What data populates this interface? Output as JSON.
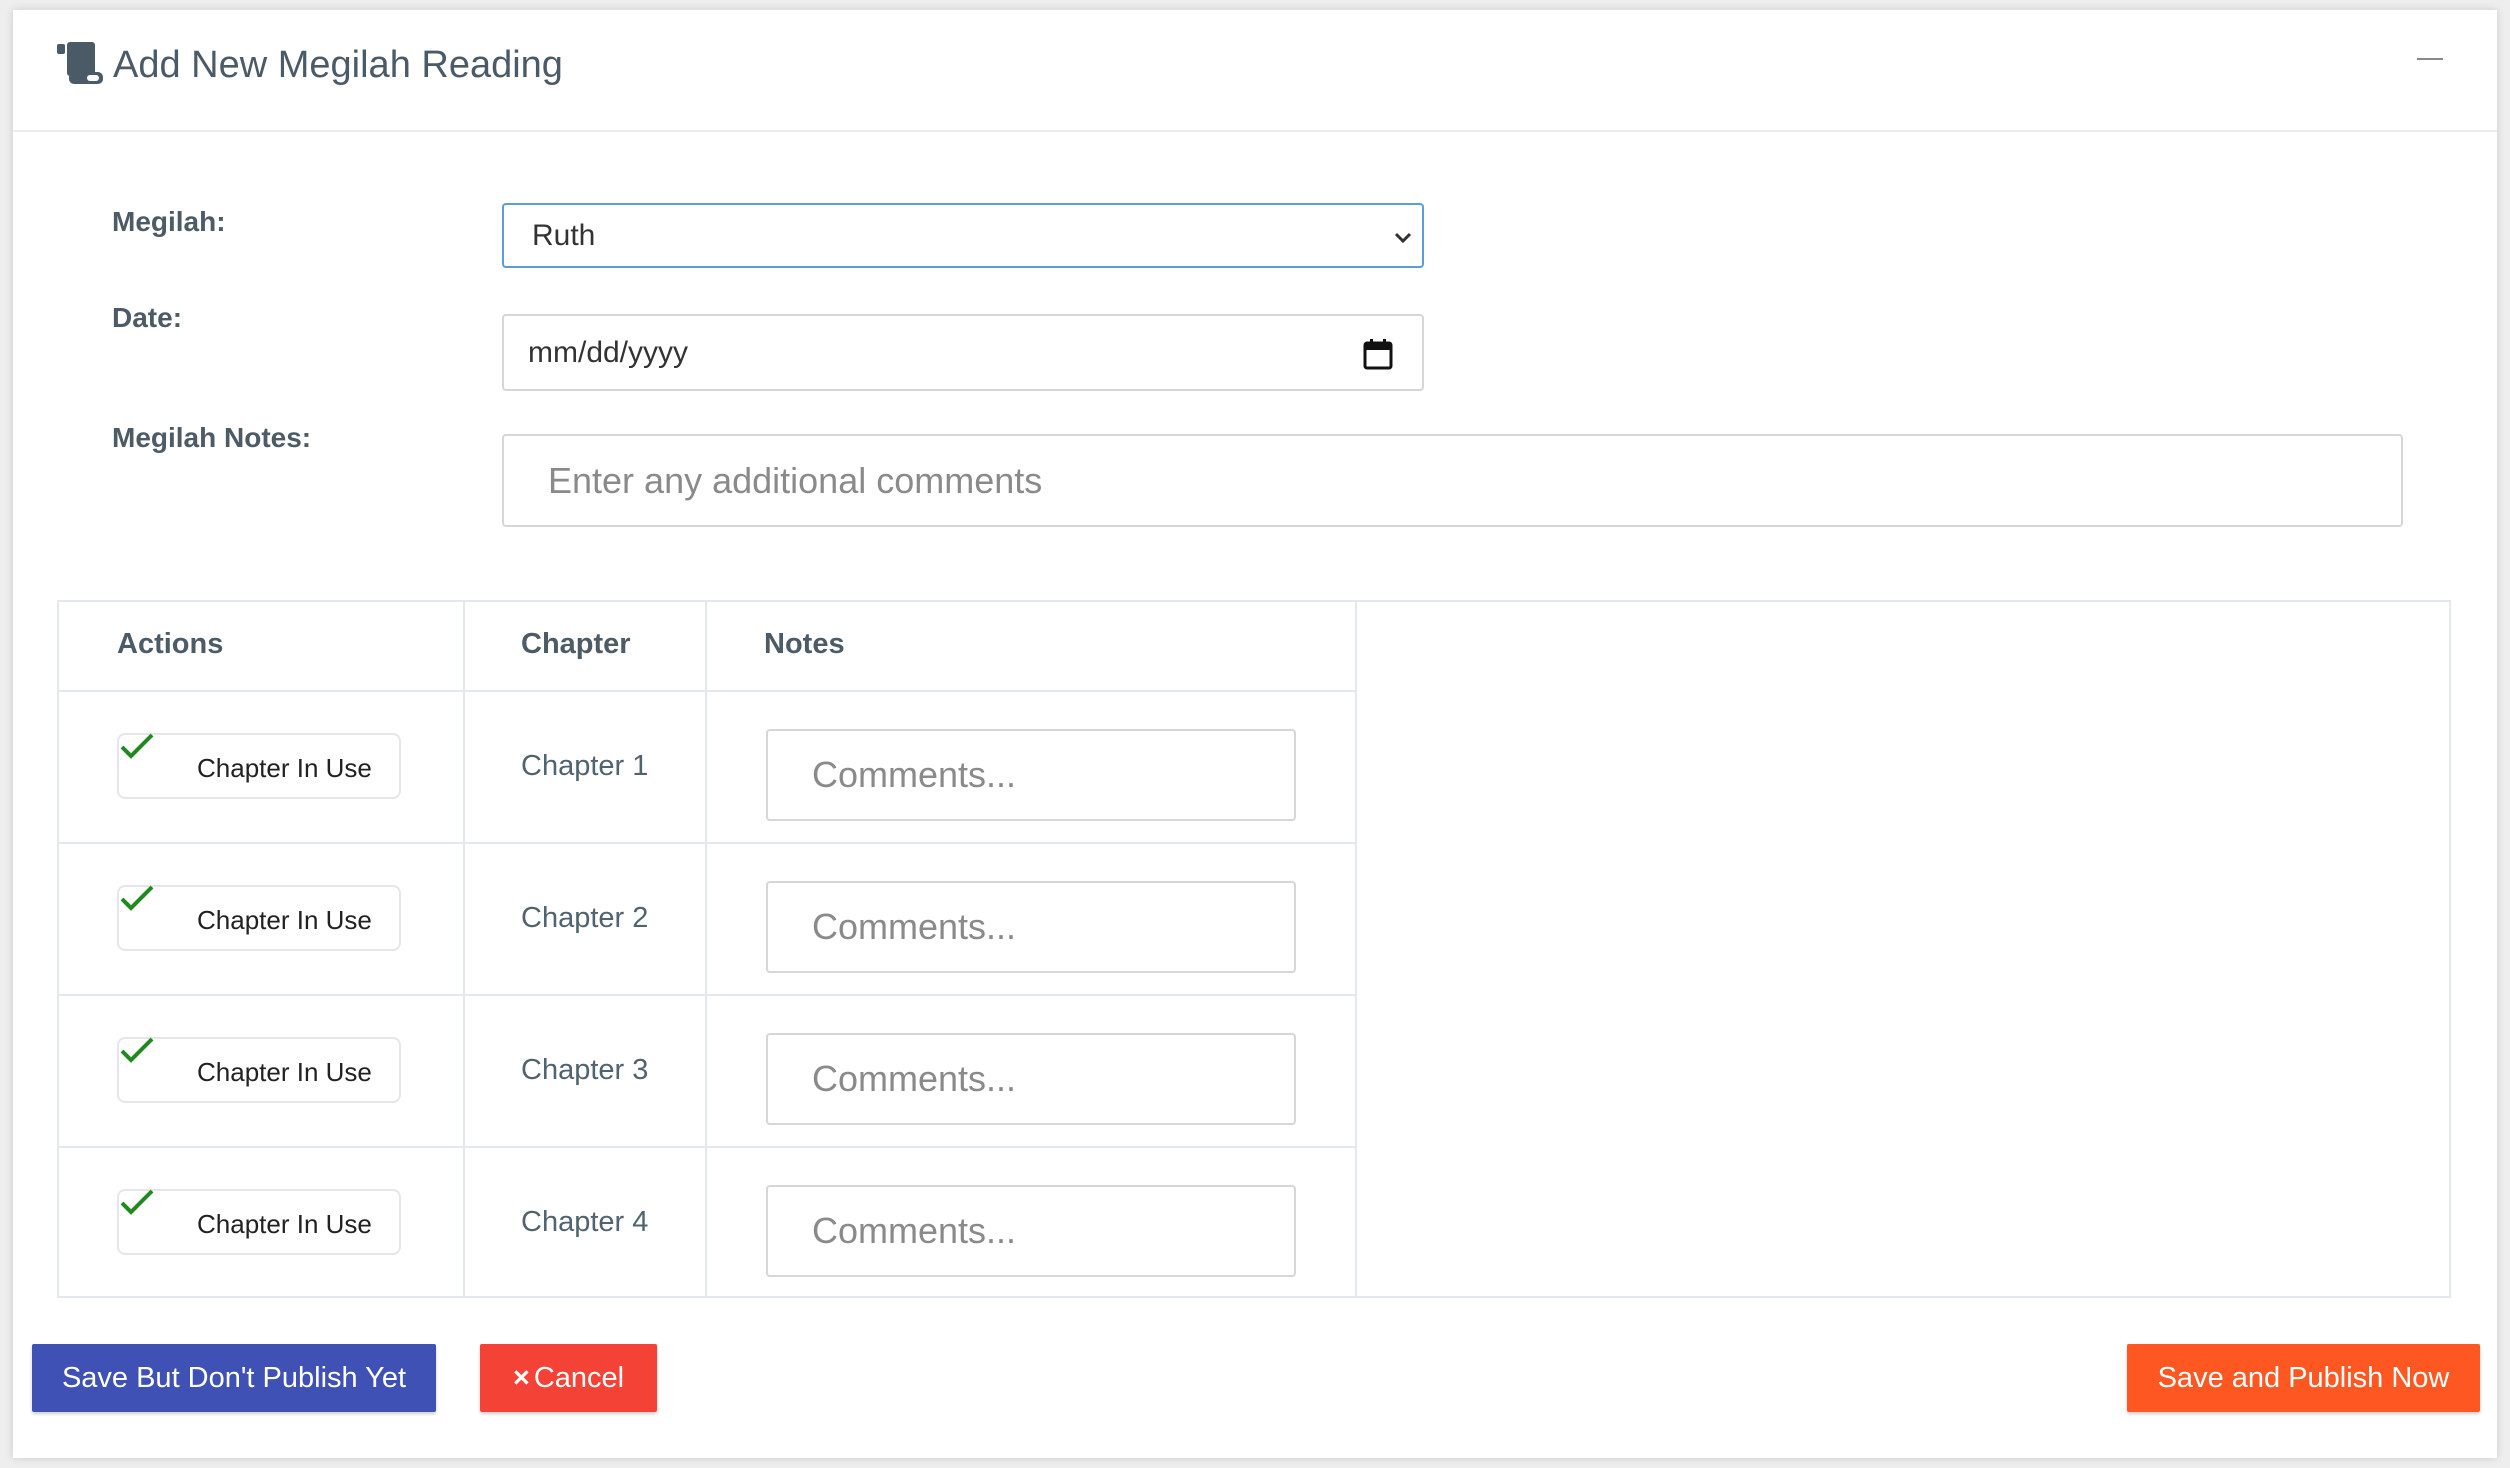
{
  "header": {
    "title": "Add New Megilah Reading",
    "icon": "scroll-icon"
  },
  "form": {
    "megilah_label": "Megilah:",
    "megilah_value": "Ruth",
    "date_label": "Date:",
    "date_placeholder": "mm/dd/yyyy",
    "notes_label": "Megilah Notes:",
    "notes_placeholder": "Enter any additional comments"
  },
  "table": {
    "headers": [
      "Actions",
      "Chapter",
      "Notes"
    ],
    "rows": [
      {
        "action": "Chapter In Use",
        "checked": true,
        "chapter": "Chapter 1",
        "notes_placeholder": "Comments..."
      },
      {
        "action": "Chapter In Use",
        "checked": true,
        "chapter": "Chapter 2",
        "notes_placeholder": "Comments..."
      },
      {
        "action": "Chapter In Use",
        "checked": true,
        "chapter": "Chapter 3",
        "notes_placeholder": "Comments..."
      },
      {
        "action": "Chapter In Use",
        "checked": true,
        "chapter": "Chapter 4",
        "notes_placeholder": "Comments..."
      }
    ]
  },
  "buttons": {
    "save_draft": "Save But Don't Publish Yet",
    "cancel": "Cancel",
    "cancel_icon": "×",
    "publish": "Save and Publish Now"
  },
  "colors": {
    "save_draft": "#3f51b5",
    "cancel": "#f44336",
    "publish": "#ff5722",
    "check": "#1f8a1f"
  }
}
